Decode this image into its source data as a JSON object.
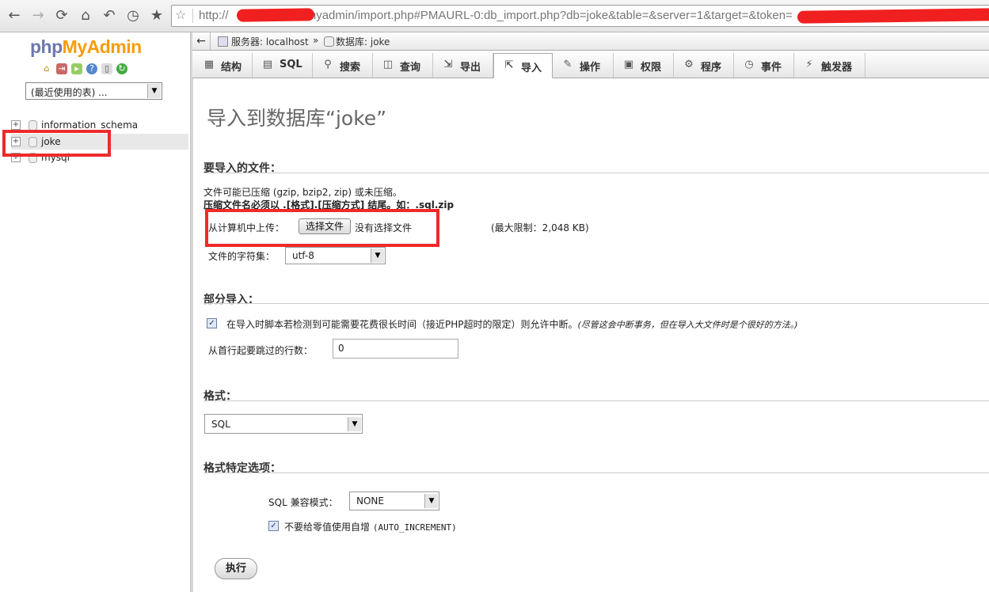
{
  "browser": {
    "url": "http://[redacted]/myadmin/import.php#PMAURL-0:db_import.php?db=joke&table=&server=1&target=&token=[redacted]",
    "url_visible_prefix": "http://",
    "url_visible_middle": "/myadmin/import.php#PMAURL-0:db_import.php?db=joke&table=&server=1&target=&token=",
    "icons": {
      "back": "←",
      "forward": "→",
      "reload": "⟳",
      "home": "⌂",
      "history": "↶",
      "clock": "◷",
      "star": "★",
      "url_star": "☆"
    }
  },
  "logo": {
    "php": "php",
    "my": "My",
    "admin": "Admin"
  },
  "left": {
    "recent_tables": "(最近使用的表) ...",
    "databases": [
      "information_schema",
      "joke",
      "mysql"
    ]
  },
  "breadcrumb": {
    "collapse": "←",
    "server_label": "服务器: localhost",
    "separator": "»",
    "db_label": "数据库: joke"
  },
  "tabs": [
    {
      "label": "结构",
      "icon": "▦"
    },
    {
      "label": "SQL",
      "icon": "▤"
    },
    {
      "label": "搜索",
      "icon": "⚲"
    },
    {
      "label": "查询",
      "icon": "◫"
    },
    {
      "label": "导出",
      "icon": "⇲"
    },
    {
      "label": "导入",
      "icon": "⇱"
    },
    {
      "label": "操作",
      "icon": "✎"
    },
    {
      "label": "权限",
      "icon": "▣"
    },
    {
      "label": "程序",
      "icon": "⚙"
    },
    {
      "label": "事件",
      "icon": "◷"
    },
    {
      "label": "触发器",
      "icon": "⚡"
    }
  ],
  "main": {
    "title": "导入到数据库“joke”",
    "file_section": {
      "heading": "要导入的文件：",
      "note_line1": "文件可能已压缩 (gzip, bzip2, zip) 或未压缩。",
      "note_line2": "压缩文件名必须以 .[格式].[压缩方式] 结尾。如：.sql.zip",
      "upload_label": "从计算机中上传：",
      "choose_file_button": "选择文件",
      "no_file_text": "没有选择文件",
      "max_limit": "(最大限制：2,048 KB)",
      "charset_label": "文件的字符集：",
      "charset_value": "utf-8"
    },
    "partial_section": {
      "heading": "部分导入：",
      "allow_interrupt_text": "在导入时脚本若检测到可能需要花费很长时间（接近PHP超时的限定）则允许中断。",
      "allow_interrupt_note": "(尽管这会中断事务，但在导入大文件时是个很好的方法。)",
      "skip_label": "从首行起要跳过的行数：",
      "skip_value": "0"
    },
    "format_section": {
      "heading": "格式：",
      "format_value": "SQL"
    },
    "options_section": {
      "heading": "格式特定选项：",
      "compat_label": "SQL 兼容模式：",
      "compat_value": "NONE",
      "auto_increment_text": "不要给零值使用自增",
      "auto_increment_code": "(AUTO_INCREMENT)"
    },
    "go_button": "执行"
  },
  "colors": {
    "annotation_red": "#ee2a2a",
    "link_blue": "#235a81",
    "logo_orange": "#f89c0e",
    "logo_blue": "#6c78af"
  }
}
